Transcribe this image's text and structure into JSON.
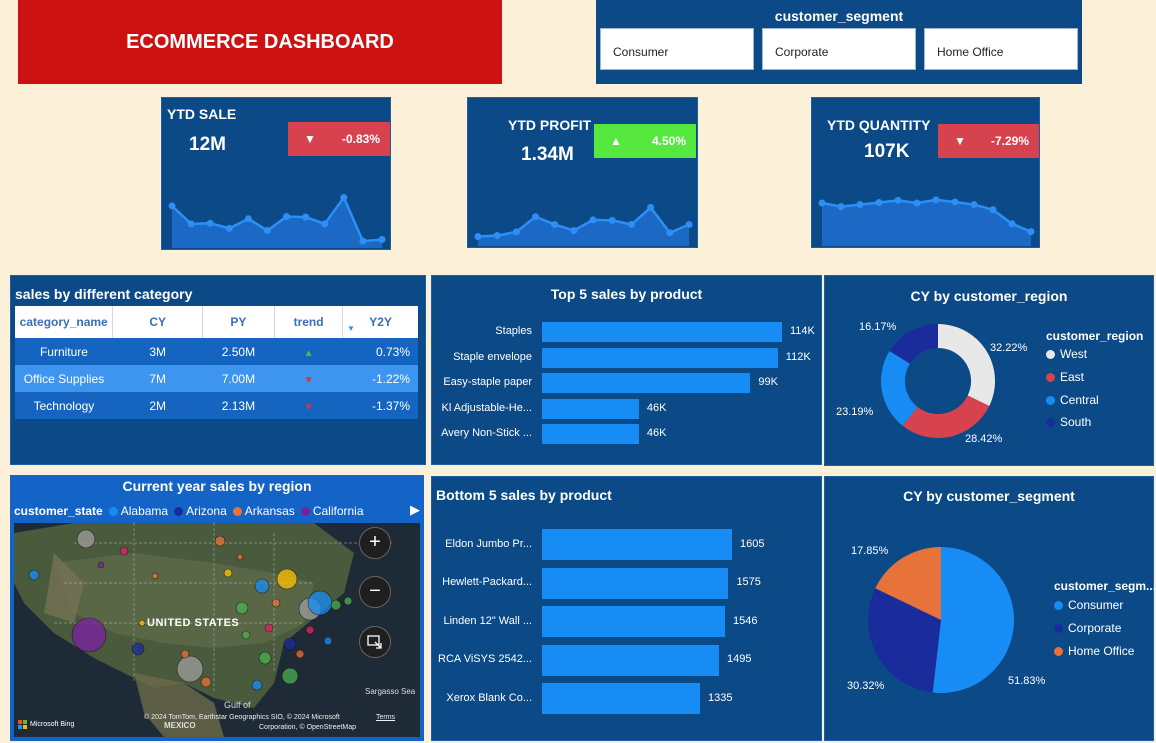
{
  "title": "ECOMMERCE DASHBOARD",
  "slicer": {
    "title": "customer_segment",
    "options": [
      "Consumer",
      "Corporate",
      "Home Office"
    ]
  },
  "kpis": [
    {
      "title": "YTD SALE",
      "value": "12M",
      "change": "-0.83%",
      "direction": "down",
      "badge_color": "#d6434f",
      "trend": [
        0.68,
        0.36,
        0.37,
        0.28,
        0.45,
        0.24,
        0.49,
        0.48,
        0.36,
        0.83,
        0.05,
        0.08
      ]
    },
    {
      "title": "YTD PROFIT",
      "value": "1.34M",
      "change": "4.50%",
      "direction": "up",
      "badge_color": "#57e83f",
      "trend": [
        0.12,
        0.14,
        0.22,
        0.55,
        0.38,
        0.25,
        0.48,
        0.47,
        0.38,
        0.75,
        0.2,
        0.38
      ]
    },
    {
      "title": "YTD QUANTITY",
      "value": "107K",
      "change": "-7.29%",
      "direction": "down",
      "badge_color": "#d6434f",
      "trend": [
        0.75,
        0.68,
        0.72,
        0.76,
        0.8,
        0.75,
        0.81,
        0.77,
        0.72,
        0.62,
        0.35,
        0.2
      ]
    }
  ],
  "category_table": {
    "title": "sales by different category",
    "headers": [
      "category_name",
      "CY",
      "PY",
      "trend",
      "Y2Y"
    ],
    "rows": [
      {
        "category_name": "Furniture",
        "CY": "3M",
        "PY": "2.50M",
        "trend": "up",
        "Y2Y": "0.73%"
      },
      {
        "category_name": "Office Supplies",
        "CY": "7M",
        "PY": "7.00M",
        "trend": "down",
        "Y2Y": "-1.22%"
      },
      {
        "category_name": "Technology",
        "CY": "2M",
        "PY": "2.13M",
        "trend": "down",
        "Y2Y": "-1.37%"
      }
    ]
  },
  "top5": {
    "title": "Top 5 sales by product",
    "chart_data": {
      "type": "bar",
      "categories": [
        "Staples",
        "Staple envelope",
        "Easy-staple paper",
        "Kl Adjustable-He...",
        "Avery Non-Stick ..."
      ],
      "values": [
        114,
        112,
        99,
        46,
        46
      ],
      "value_labels": [
        "114K",
        "112K",
        "99K",
        "46K",
        "46K"
      ],
      "xlim": [
        0,
        114
      ]
    }
  },
  "bottom5": {
    "title": "Bottom 5 sales by product",
    "chart_data": {
      "type": "bar",
      "categories": [
        "Eldon Jumbo Pr...",
        "Hewlett-Packard...",
        "Linden 12\" Wall ...",
        "RCA ViSYS 2542...",
        "Xerox Blank Co..."
      ],
      "values": [
        1605,
        1575,
        1546,
        1495,
        1335
      ],
      "value_labels": [
        "1605",
        "1575",
        "1546",
        "1495",
        "1335"
      ],
      "xlim": [
        0,
        1605
      ]
    }
  },
  "region": {
    "title": "CY by customer_region",
    "legend_title": "customer_region",
    "chart_data": {
      "type": "pie",
      "categories": [
        "West",
        "East",
        "Central",
        "South"
      ],
      "values": [
        32.22,
        28.42,
        23.19,
        16.17
      ],
      "value_labels": [
        "32.22%",
        "28.42%",
        "23.19%",
        "16.17%"
      ],
      "colors": [
        "#e8e8e8",
        "#d6434f",
        "#178cf5",
        "#1a2c9c"
      ]
    }
  },
  "segment": {
    "title": "CY by customer_segment",
    "legend_title": "customer_segm...",
    "chart_data": {
      "type": "pie",
      "categories": [
        "Consumer",
        "Corporate",
        "Home Office"
      ],
      "values": [
        51.83,
        30.32,
        17.85
      ],
      "value_labels": [
        "51.83%",
        "30.32%",
        "17.85%"
      ],
      "colors": [
        "#178cf5",
        "#1a2c9c",
        "#e8733a"
      ]
    }
  },
  "map": {
    "title": "Current year sales by region",
    "legend_title": "customer_state",
    "legend": [
      {
        "name": "Alabama",
        "color": "#178cf5"
      },
      {
        "name": "Arizona",
        "color": "#1a2c9c"
      },
      {
        "name": "Arkansas",
        "color": "#e8733a"
      },
      {
        "name": "California",
        "color": "#7b1fa2"
      }
    ],
    "country_label": "UNITED STATES",
    "sea_label": "Sargasso Sea",
    "gulf_label": "Gulf of",
    "mexico_label": "MEXICO",
    "attribution": "© 2024 TomTom, Earthstar Geographics SIO, © 2024 Microsoft",
    "attribution2": "Corporation, © OpenStreetMap",
    "terms": "Terms",
    "bing": "Microsoft Bing",
    "icons": {
      "zoom_in": "+",
      "zoom_out": "−",
      "next": "▶"
    }
  }
}
